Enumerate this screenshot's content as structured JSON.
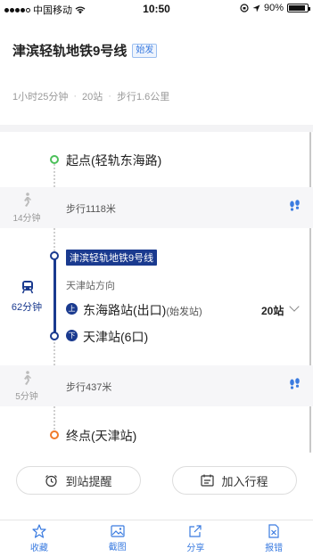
{
  "status_bar": {
    "carrier": "中国移动",
    "time": "10:50",
    "battery": "90%",
    "battery_level": 0.9
  },
  "header": {
    "title": "津滨轻轨地铁9号线",
    "badge": "始发",
    "summary": {
      "duration": "1小时25分钟",
      "stations": "20站",
      "walk": "步行1.6公里"
    }
  },
  "route": {
    "start": "起点(轻轨东海路)",
    "walk1": {
      "minutes": "14分钟",
      "text": "步行1118米"
    },
    "transit": {
      "minutes": "62分钟",
      "line_name": "津滨轻轨地铁9号线",
      "direction": "天津站方向",
      "board_tag": "上",
      "board_station": "东海路站(出口)",
      "board_note": "(始发站)",
      "stops": "20站",
      "alight_tag": "下",
      "alight_station": "天津站(6口)"
    },
    "walk2": {
      "minutes": "5分钟",
      "text": "步行437米"
    },
    "end": "终点(天津站)"
  },
  "actions": {
    "remind": "到站提醒",
    "add_trip": "加入行程"
  },
  "tabbar": [
    {
      "label": "收藏",
      "icon": "star-icon"
    },
    {
      "label": "截图",
      "icon": "image-icon"
    },
    {
      "label": "分享",
      "icon": "share-icon"
    },
    {
      "label": "报错",
      "icon": "report-icon"
    }
  ],
  "colors": {
    "accent": "#3a7be0",
    "line": "#1a3a8f",
    "start": "#4cc05a",
    "end": "#f07a2a"
  }
}
